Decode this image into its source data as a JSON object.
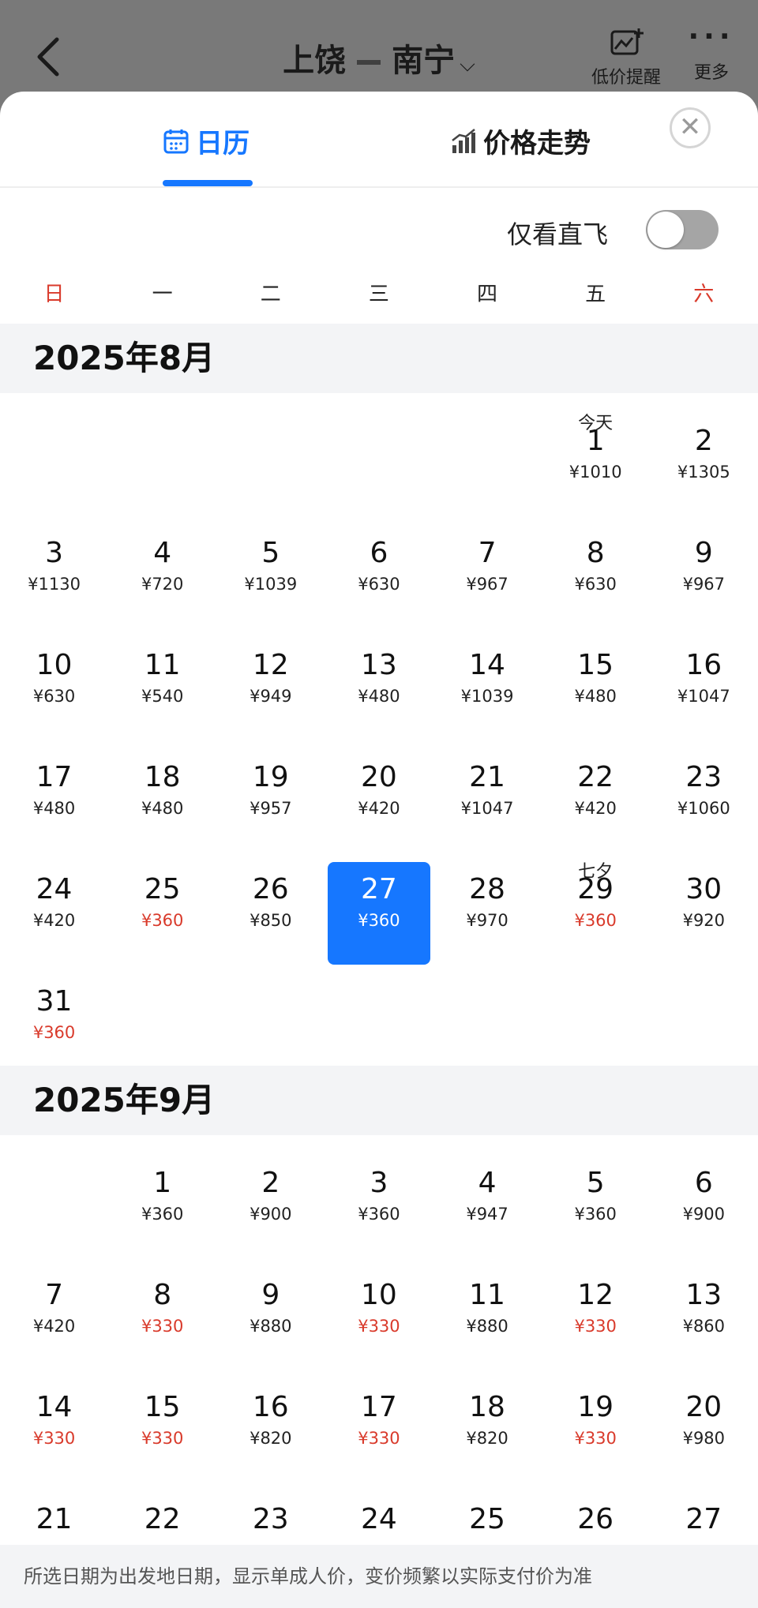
{
  "header": {
    "from": "上饶",
    "to": "南宁",
    "alert_label": "低价提醒",
    "more_label": "更多"
  },
  "tabs": [
    {
      "label": "日历",
      "active": true
    },
    {
      "label": "价格走势",
      "active": false
    }
  ],
  "filter": {
    "direct_only_label": "仅看直飞",
    "direct_only": false
  },
  "weekdays": [
    "日",
    "一",
    "二",
    "三",
    "四",
    "五",
    "六"
  ],
  "colors": {
    "accent": "#1677ff",
    "low_price": "#d93a2b",
    "weekend": "#d93a2b"
  },
  "months": [
    {
      "title": "2025年8月",
      "leading_blanks": 5,
      "days": [
        {
          "day": "1",
          "price": "¥1010",
          "tag": "今天"
        },
        {
          "day": "2",
          "price": "¥1305"
        },
        {
          "day": "3",
          "price": "¥1130"
        },
        {
          "day": "4",
          "price": "¥720"
        },
        {
          "day": "5",
          "price": "¥1039"
        },
        {
          "day": "6",
          "price": "¥630"
        },
        {
          "day": "7",
          "price": "¥967"
        },
        {
          "day": "8",
          "price": "¥630"
        },
        {
          "day": "9",
          "price": "¥967"
        },
        {
          "day": "10",
          "price": "¥630"
        },
        {
          "day": "11",
          "price": "¥540"
        },
        {
          "day": "12",
          "price": "¥949"
        },
        {
          "day": "13",
          "price": "¥480"
        },
        {
          "day": "14",
          "price": "¥1039"
        },
        {
          "day": "15",
          "price": "¥480"
        },
        {
          "day": "16",
          "price": "¥1047"
        },
        {
          "day": "17",
          "price": "¥480"
        },
        {
          "day": "18",
          "price": "¥480"
        },
        {
          "day": "19",
          "price": "¥957"
        },
        {
          "day": "20",
          "price": "¥420"
        },
        {
          "day": "21",
          "price": "¥1047"
        },
        {
          "day": "22",
          "price": "¥420"
        },
        {
          "day": "23",
          "price": "¥1060"
        },
        {
          "day": "24",
          "price": "¥420"
        },
        {
          "day": "25",
          "price": "¥360",
          "low": true
        },
        {
          "day": "26",
          "price": "¥850"
        },
        {
          "day": "27",
          "price": "¥360",
          "selected": true
        },
        {
          "day": "28",
          "price": "¥970"
        },
        {
          "day": "29",
          "price": "¥360",
          "low": true,
          "tag": "七夕"
        },
        {
          "day": "30",
          "price": "¥920"
        },
        {
          "day": "31",
          "price": "¥360",
          "low": true
        }
      ]
    },
    {
      "title": "2025年9月",
      "leading_blanks": 1,
      "days": [
        {
          "day": "1",
          "price": "¥360"
        },
        {
          "day": "2",
          "price": "¥900"
        },
        {
          "day": "3",
          "price": "¥360"
        },
        {
          "day": "4",
          "price": "¥947"
        },
        {
          "day": "5",
          "price": "¥360"
        },
        {
          "day": "6",
          "price": "¥900"
        },
        {
          "day": "7",
          "price": "¥420"
        },
        {
          "day": "8",
          "price": "¥330",
          "low": true
        },
        {
          "day": "9",
          "price": "¥880"
        },
        {
          "day": "10",
          "price": "¥330",
          "low": true
        },
        {
          "day": "11",
          "price": "¥880"
        },
        {
          "day": "12",
          "price": "¥330",
          "low": true
        },
        {
          "day": "13",
          "price": "¥860"
        },
        {
          "day": "14",
          "price": "¥330",
          "low": true
        },
        {
          "day": "15",
          "price": "¥330",
          "low": true
        },
        {
          "day": "16",
          "price": "¥820"
        },
        {
          "day": "17",
          "price": "¥330",
          "low": true
        },
        {
          "day": "18",
          "price": "¥820"
        },
        {
          "day": "19",
          "price": "¥330",
          "low": true
        },
        {
          "day": "20",
          "price": "¥980"
        },
        {
          "day": "21",
          "price": ""
        },
        {
          "day": "22",
          "price": ""
        },
        {
          "day": "23",
          "price": ""
        },
        {
          "day": "24",
          "price": ""
        },
        {
          "day": "25",
          "price": ""
        },
        {
          "day": "26",
          "price": ""
        },
        {
          "day": "27",
          "price": ""
        }
      ]
    }
  ],
  "footer_note": "所选日期为出发地日期，显示单成人价，变价频繁以实际支付价为准"
}
